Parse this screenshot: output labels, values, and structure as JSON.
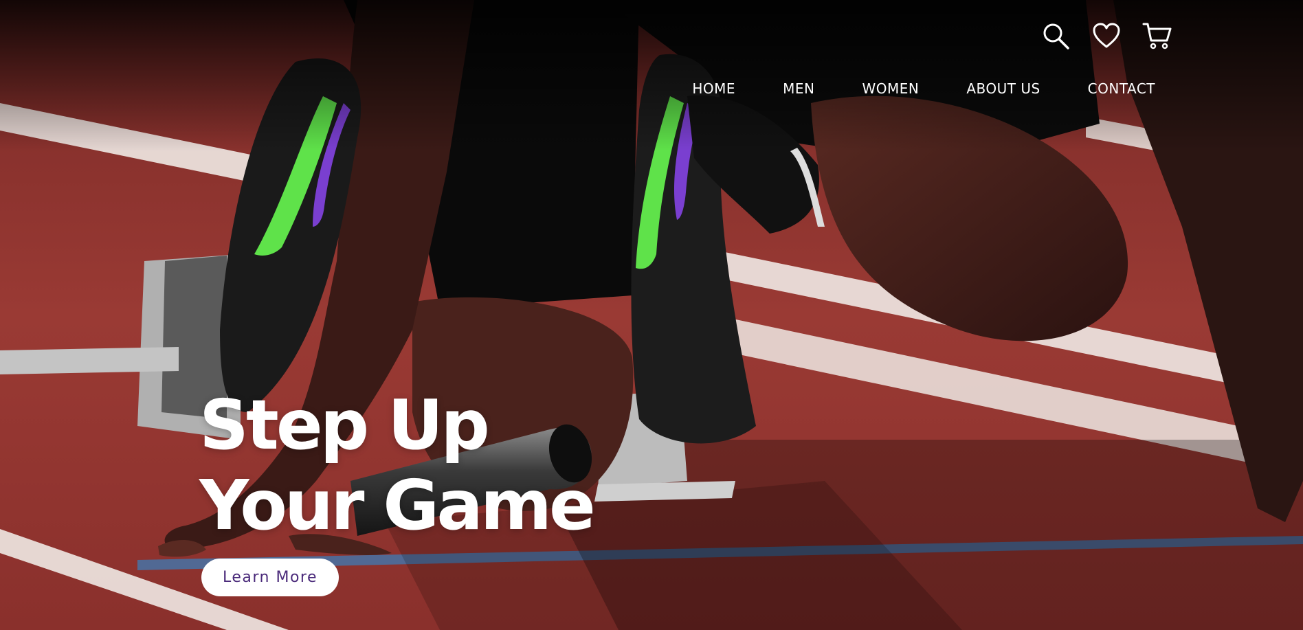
{
  "header": {
    "icons": [
      {
        "name": "search-icon",
        "label": "Search"
      },
      {
        "name": "heart-icon",
        "label": "Wishlist"
      },
      {
        "name": "cart-icon",
        "label": "Cart"
      }
    ]
  },
  "nav": {
    "items": [
      {
        "label": "HOME"
      },
      {
        "label": "MEN"
      },
      {
        "label": "WOMEN"
      },
      {
        "label": "ABOUT US"
      },
      {
        "label": "CONTACT"
      }
    ]
  },
  "hero": {
    "title_line_1": "Step Up",
    "title_line_2": "Your Game",
    "cta_label": "Learn More"
  },
  "colors": {
    "track": "#8f3530",
    "lane_line": "#f2eeea",
    "shoe_accent": "#5fe24a",
    "shoe_stripe": "#7a3fd0",
    "cta_text": "#4a2a7a",
    "nav_text": "#ffffff"
  }
}
